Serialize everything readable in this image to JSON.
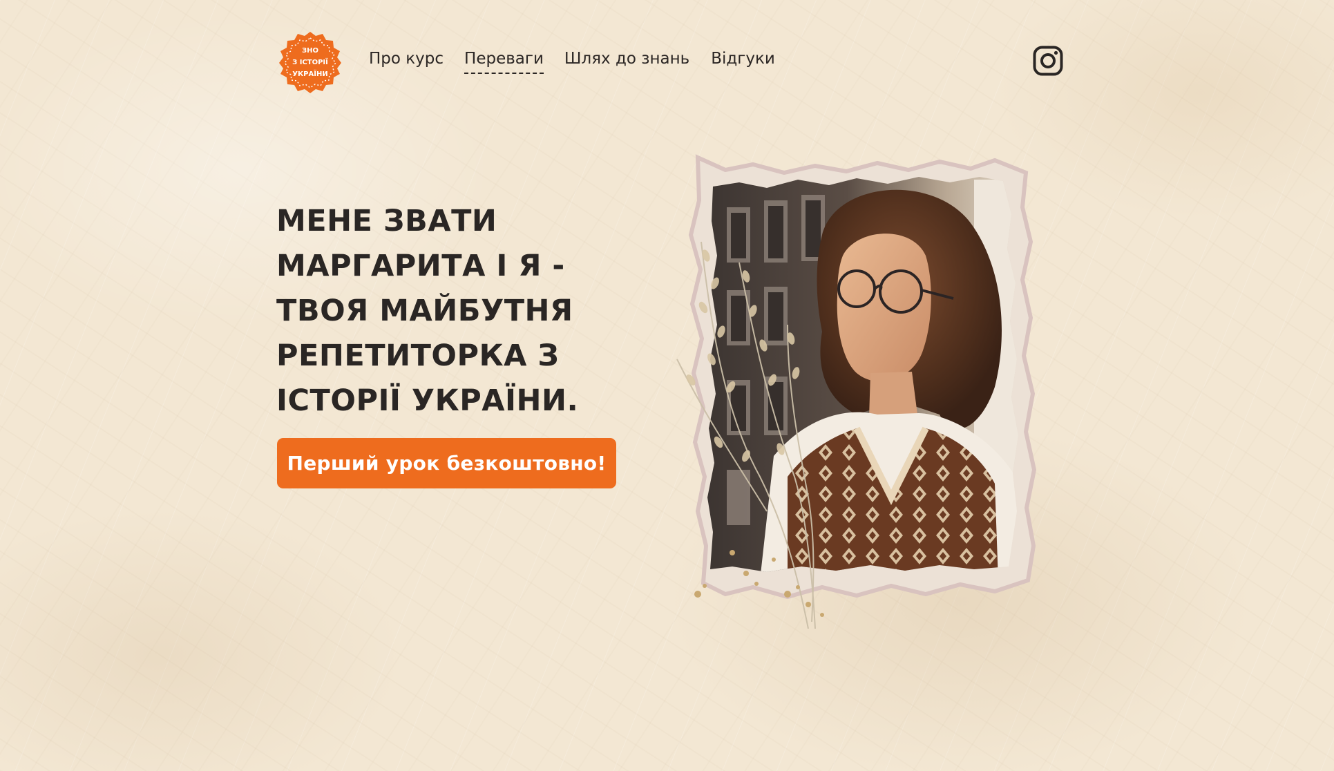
{
  "logo": {
    "line1": "ЗНО",
    "line2": "З ІСТОРІЇ",
    "line3": "УКРАЇНИ",
    "color": "#ee6c1e"
  },
  "nav": {
    "items": [
      {
        "label": "Про курс"
      },
      {
        "label": "Переваги",
        "active": true
      },
      {
        "label": "Шлях до знань"
      },
      {
        "label": "Відгуки"
      }
    ]
  },
  "social": {
    "icon": "instagram-icon"
  },
  "hero": {
    "title": "Мене звати Маргарита і я - твоя майбутня репетиторка з історії України.",
    "cta_label": "Перший урок безкоштовно!",
    "accent_color": "#ee6c1e",
    "photo_alt": "portrait-photo"
  }
}
